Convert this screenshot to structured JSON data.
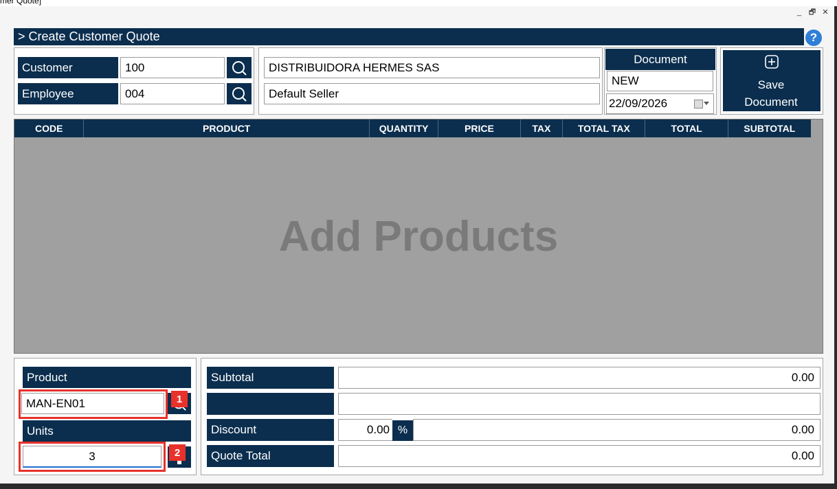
{
  "window": {
    "title": "mer Quote]",
    "minimize_glyph": "_",
    "restore_glyph": "🗗",
    "close_glyph": "✕",
    "top_glyph_min": "–",
    "top_glyph_max": "▪"
  },
  "header": {
    "title": "> Create Customer Quote",
    "help_label": "?"
  },
  "customer": {
    "label": "Customer",
    "value": "100",
    "name": "DISTRIBUIDORA HERMES SAS"
  },
  "employee": {
    "label": "Employee",
    "value": "004",
    "name": "Default Seller"
  },
  "document": {
    "label": "Document",
    "number": "NEW",
    "date": "22/09/2026"
  },
  "save_button": {
    "label": "Save Document"
  },
  "grid": {
    "columns": [
      "CODE",
      "PRODUCT",
      "QUANTITY",
      "PRICE",
      "TAX",
      "TOTAL TAX",
      "TOTAL",
      "SUBTOTAL"
    ],
    "empty_text": "Add Products"
  },
  "entry": {
    "product_label": "Product",
    "product_value": "MAN-EN01",
    "units_label": "Units",
    "units_value": "3",
    "badge_1": "1",
    "badge_2": "2"
  },
  "totals": {
    "subtotal_label": "Subtotal",
    "subtotal_value": "0.00",
    "blank_label": "",
    "blank_value": "",
    "discount_label": "Discount",
    "discount_percent": "0.00",
    "discount_percent_symbol": "%",
    "discount_value": "0.00",
    "quote_total_label": "Quote Total",
    "quote_total_value": "0.00"
  },
  "colors": {
    "navy": "#0b2e4e",
    "grid_bg": "#a0a0a0",
    "highlight": "#e8312b",
    "help": "#2f7fd6"
  }
}
